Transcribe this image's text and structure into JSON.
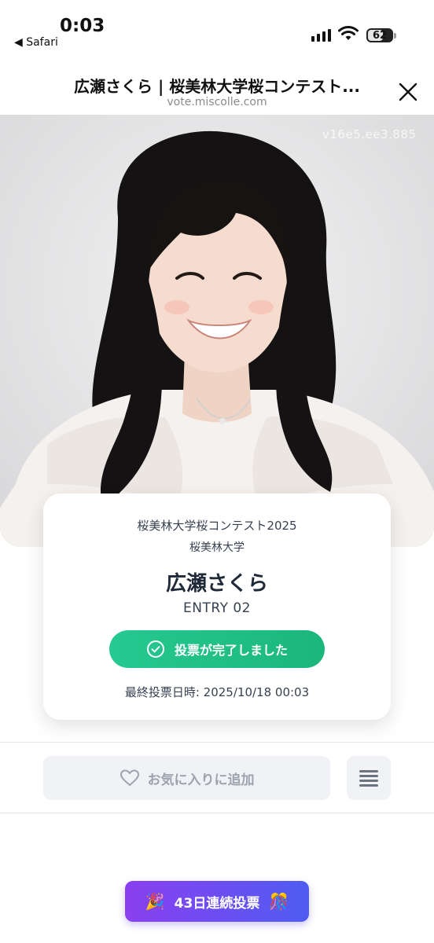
{
  "status_bar": {
    "time": "0:03",
    "back_app": "◀ Safari",
    "battery": "62"
  },
  "browser": {
    "title": "広瀬さくら | 桜美林大学桜コンテスト...",
    "url": "vote.miscolle.com"
  },
  "hero": {
    "watermark": "v16e5.ee3.885"
  },
  "card": {
    "contest": "桜美林大学桜コンテスト2025",
    "school": "桜美林大学",
    "name": "広瀬さくら",
    "entry": "ENTRY 02",
    "vote_button": "投票が完了しました",
    "last_vote": "最終投票日時: 2025/10/18 00:03"
  },
  "actions": {
    "favorite": "お気に入りに追加"
  },
  "streak": {
    "label": "43日連続投票",
    "left_emoji": "🎉",
    "right_emoji": "🎊"
  },
  "colors": {
    "vote_green": "#1ec38b",
    "streak_purple": "#8a3ff0",
    "streak_blue": "#4f5df1"
  }
}
